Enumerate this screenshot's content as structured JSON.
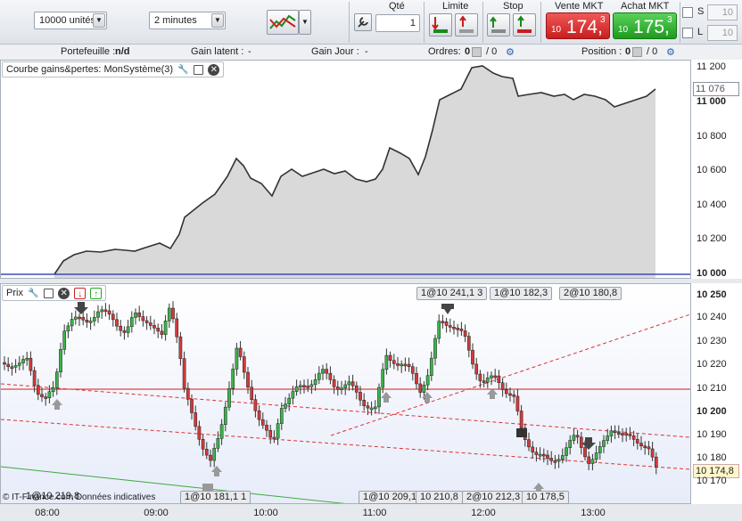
{
  "toolbar": {
    "quantity": "10000 unités",
    "timeframe": "2 minutes",
    "qty_label": "Qté",
    "qty_value": "1",
    "limit_label": "Limite",
    "stop_label": "Stop",
    "sell_label": "Vente MKT",
    "sell_prefix": "10",
    "sell_main": "174,",
    "sell_sup": "3",
    "buy_label": "Achat MKT",
    "buy_prefix": "10",
    "buy_main": "175,",
    "buy_sup": "3",
    "s_label": "S",
    "l_label": "L",
    "s_value": "10",
    "l_value": "10",
    "colors": {
      "sell": "#d62b2b",
      "buy": "#2aa52a"
    }
  },
  "status": {
    "portfolio_label": "Portefeuille :",
    "portfolio_value": "n/d",
    "latent_label": "Gain latent :",
    "latent_value": "-",
    "day_label": "Gain Jour :",
    "day_value": "-",
    "orders_label": "Ordres:",
    "orders_a": "0",
    "orders_b": "/ 0",
    "position_label": "Position :",
    "position_a": "0",
    "position_b": "/ 0"
  },
  "pnl_panel": {
    "title": "Courbe gains&pertes: MonSystème(3)",
    "y_labels": [
      "11 200",
      "11 000",
      "10 800",
      "10 600",
      "10 400",
      "10 200",
      "10 000"
    ],
    "current": "11 076"
  },
  "price_panel": {
    "title": "Prix",
    "y_labels": [
      "10 250",
      "10 240",
      "10 230",
      "10 220",
      "10 210",
      "10 200",
      "10 190",
      "10 180",
      "10 170"
    ],
    "current": "10 174,8",
    "order_tags": [
      "1@10 241,1 3",
      "1@10 182,3",
      "2@10 180,8",
      "1@10 181,1 1",
      "1@10 209,1",
      "10 210,8",
      "2@10 212,3",
      "10 178,5"
    ],
    "copyright": "© IT-Finance.com  Données indicatives",
    "bottom_left": "1@10 219,8"
  },
  "x_axis": [
    "08:00",
    "09:00",
    "10:00",
    "11:00",
    "12:00",
    "13:00"
  ]
}
